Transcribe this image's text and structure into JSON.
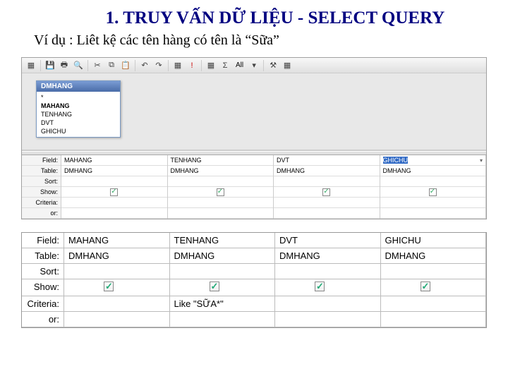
{
  "title": "1. TRUY VẤN DỮ LIỆU - SELECT QUERY",
  "subtitle": "Ví dụ : Liêt kệ các tên hàng có tên là “Sữa”",
  "toolbar": {
    "scope": "All"
  },
  "table_box": {
    "name": "DMHANG",
    "fields": [
      "*",
      "MAHANG",
      "TENHANG",
      "DVT",
      "GHICHU"
    ],
    "bold_fields": [
      "MAHANG"
    ]
  },
  "small_grid": {
    "labels": [
      "Field:",
      "Table:",
      "Sort:",
      "Show:",
      "Criteria:",
      "or:"
    ],
    "cols": [
      {
        "field": "MAHANG",
        "table": "DMHANG",
        "sort": "",
        "show": true,
        "criteria": "",
        "or": ""
      },
      {
        "field": "TENHANG",
        "table": "DMHANG",
        "sort": "",
        "show": true,
        "criteria": "",
        "or": ""
      },
      {
        "field": "DVT",
        "table": "DMHANG",
        "sort": "",
        "show": true,
        "criteria": "",
        "or": ""
      },
      {
        "field": "GHICHU",
        "table": "DMHANG",
        "sort": "",
        "show": true,
        "criteria": "",
        "or": "",
        "highlighted": true
      }
    ]
  },
  "big_grid": {
    "labels": [
      "Field:",
      "Table:",
      "Sort:",
      "Show:",
      "Criteria:",
      "or:"
    ],
    "cols": [
      {
        "field": "MAHANG",
        "table": "DMHANG",
        "sort": "",
        "show": true,
        "criteria": "",
        "or": ""
      },
      {
        "field": "TENHANG",
        "table": "DMHANG",
        "sort": "",
        "show": true,
        "criteria": "Like \"SỮA*\"",
        "or": ""
      },
      {
        "field": "DVT",
        "table": "DMHANG",
        "sort": "",
        "show": true,
        "criteria": "",
        "or": ""
      },
      {
        "field": "GHICHU",
        "table": "DMHANG",
        "sort": "",
        "show": true,
        "criteria": "",
        "or": ""
      }
    ]
  }
}
